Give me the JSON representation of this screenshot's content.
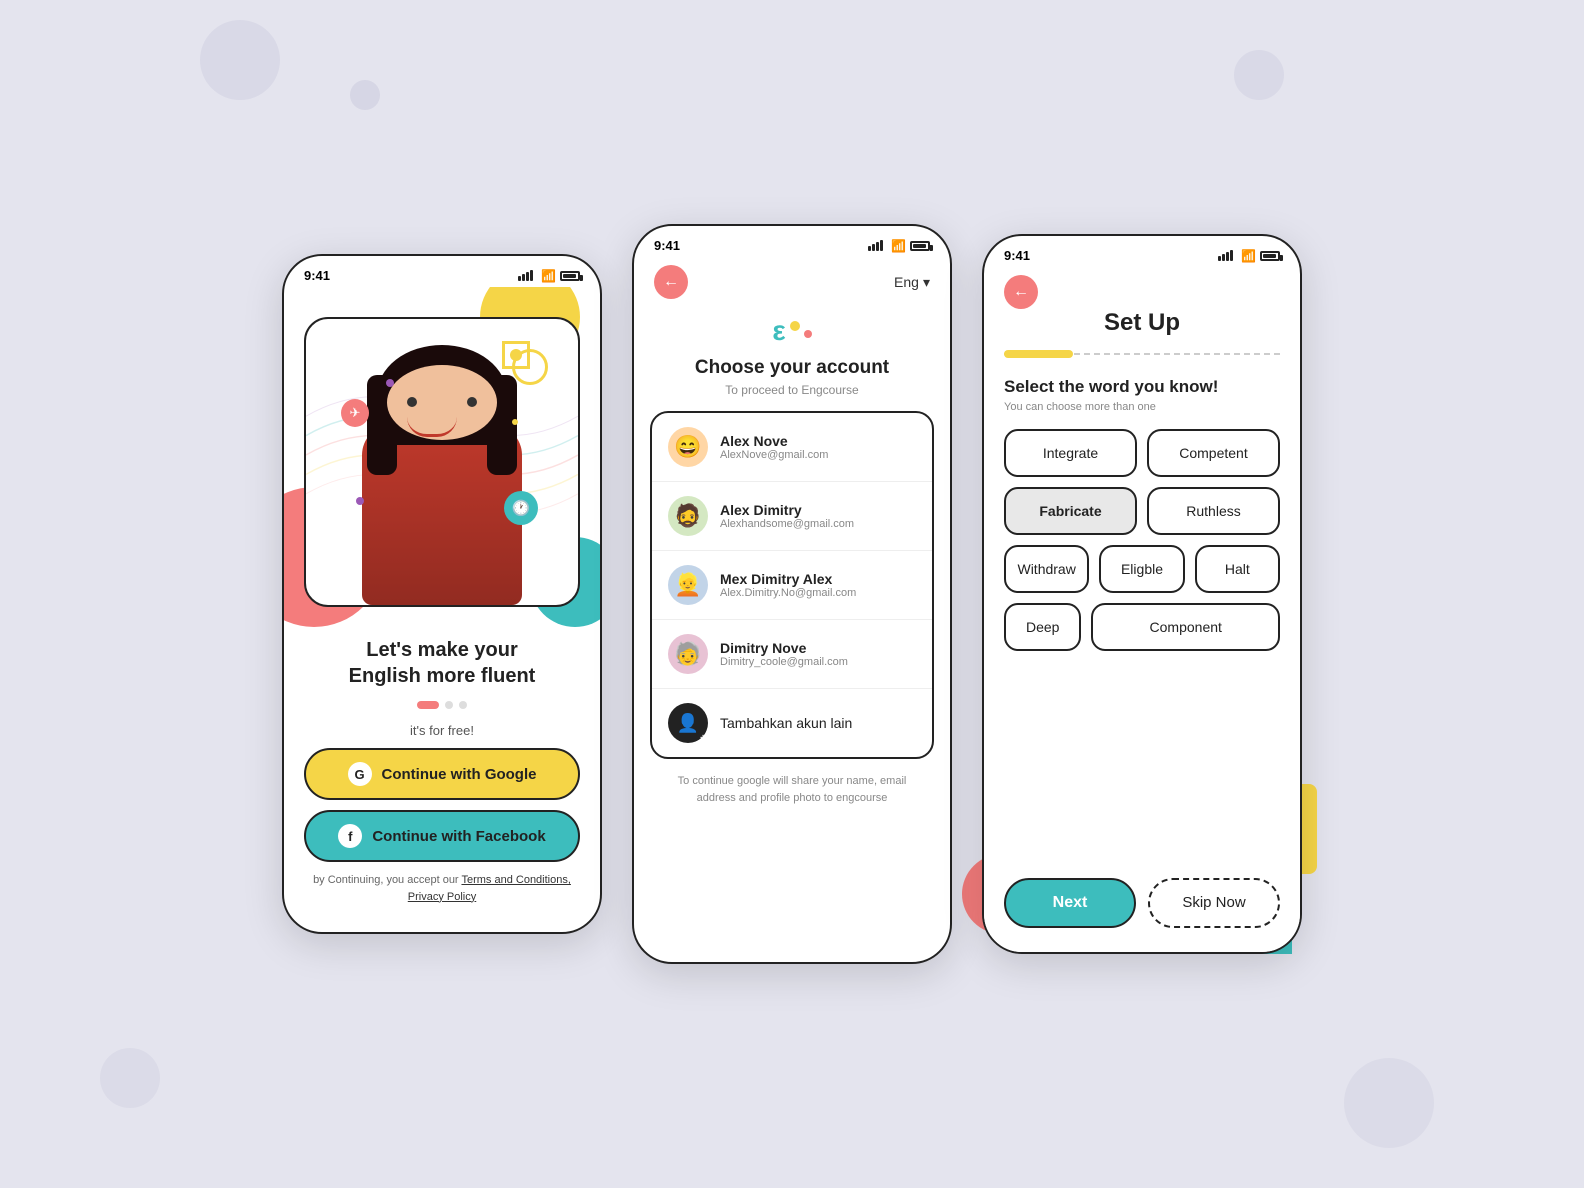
{
  "page": {
    "bg_color": "#e4e4ee"
  },
  "phone1": {
    "status_time": "9:41",
    "headline_line1": "Let's make your",
    "headline_line2": "English more fluent",
    "free_label": "it's for free!",
    "google_btn": "Continue with Google",
    "facebook_btn": "Continue with Facebook",
    "terms_prefix": "by Continuing, you accept our ",
    "terms_link": "Terms and Conditions, Privacy Policy"
  },
  "phone2": {
    "status_time": "9:41",
    "back_icon": "←",
    "language": "Eng",
    "chevron": "▾",
    "title": "Choose your account",
    "subtitle": "To proceed to Engcourse",
    "accounts": [
      {
        "name": "Alex Nove",
        "email": "AlexNove@gmail.com",
        "emoji": "😄"
      },
      {
        "name": "Alex Dimitry",
        "email": "Alexhandsome@gmail.com",
        "emoji": "🧔"
      },
      {
        "name": "Mex Dimitry Alex",
        "email": "Alex.Dimitry.No@gmail.com",
        "emoji": "👱"
      },
      {
        "name": "Dimitry Nove",
        "email": "Dimitry_coole@gmail.com",
        "emoji": "🧓"
      }
    ],
    "add_account": "Tambahkan akun lain",
    "footer": "To continue google will share your name, email address and profile photo to engcourse"
  },
  "phone3": {
    "status_time": "9:41",
    "back_icon": "←",
    "title": "Set Up",
    "progress_percent": 25,
    "subtitle": "Select the word you know!",
    "hint": "You can choose more than one",
    "words": [
      {
        "label": "Integrate",
        "selected": false
      },
      {
        "label": "Competent",
        "selected": false
      },
      {
        "label": "Fabricate",
        "selected": true
      },
      {
        "label": "Ruthless",
        "selected": false
      },
      {
        "label": "Withdraw",
        "selected": false
      },
      {
        "label": "Eligble",
        "selected": false
      },
      {
        "label": "Halt",
        "selected": false
      },
      {
        "label": "Deep",
        "selected": false
      },
      {
        "label": "Component",
        "selected": false
      }
    ],
    "next_btn": "Next",
    "skip_btn": "Skip Now"
  }
}
